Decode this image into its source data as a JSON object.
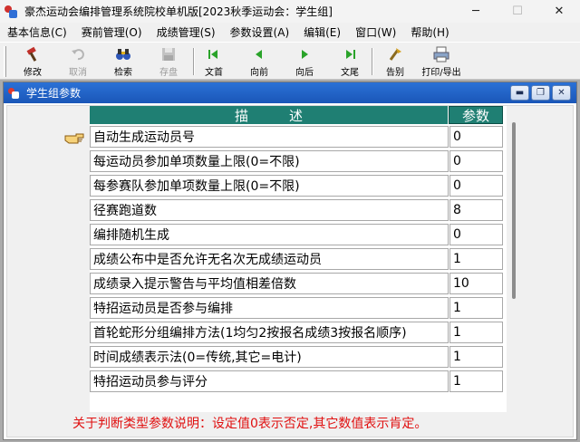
{
  "window": {
    "title": "豪杰运动会编排管理系统院校单机版[2023秋季运动会：学生组]",
    "min_symbol": "─",
    "max_symbol": "☐",
    "close_symbol": "✕"
  },
  "menu": [
    {
      "label": "基本信息(C)"
    },
    {
      "label": "赛前管理(O)"
    },
    {
      "label": "成绩管理(S)"
    },
    {
      "label": "参数设置(A)"
    },
    {
      "label": "编辑(E)"
    },
    {
      "label": "窗口(W)"
    },
    {
      "label": "帮助(H)"
    }
  ],
  "toolbar": {
    "modify": {
      "label": "修改",
      "icon": "hammer-icon"
    },
    "cancel": {
      "label": "取消",
      "icon": "undo-icon"
    },
    "search": {
      "label": "检索",
      "icon": "binoculars-icon"
    },
    "save": {
      "label": "存盘",
      "icon": "floppy-icon"
    },
    "first": {
      "label": "文首",
      "icon": "first-icon"
    },
    "prev": {
      "label": "向前",
      "icon": "prev-icon"
    },
    "next": {
      "label": "向后",
      "icon": "next-icon"
    },
    "last": {
      "label": "文尾",
      "icon": "last-icon"
    },
    "exit": {
      "label": "告别",
      "icon": "exit-icon"
    },
    "print": {
      "label": "打印/导出",
      "icon": "printer-icon"
    }
  },
  "child": {
    "title": "学生组参数",
    "min_symbol": "▬",
    "restore_symbol": "❐",
    "close_symbol": "✕"
  },
  "grid": {
    "headers": {
      "desc": "描　　　述",
      "value": "参数"
    },
    "rows": [
      {
        "desc": "自动生成运动员号",
        "value": "0"
      },
      {
        "desc": "每运动员参加单项数量上限(0=不限)",
        "value": "0"
      },
      {
        "desc": "每参赛队参加单项数量上限(0=不限)",
        "value": "0"
      },
      {
        "desc": "径赛跑道数",
        "value": "8"
      },
      {
        "desc": "编排随机生成",
        "value": "0"
      },
      {
        "desc": "成绩公布中是否允许无名次无成绩运动员",
        "value": "1"
      },
      {
        "desc": "成绩录入提示警告与平均值相差倍数",
        "value": "10"
      },
      {
        "desc": "特招运动员是否参与编排",
        "value": "1"
      },
      {
        "desc": "首轮蛇形分组编排方法(1均匀2按报名成绩3按报名顺序)",
        "value": "1"
      },
      {
        "desc": "时间成绩表示法(0=传统,其它=电计)",
        "value": "1"
      },
      {
        "desc": "特招运动员参与评分",
        "value": "1"
      }
    ]
  },
  "note": "关于判断类型参数说明：设定值0表示否定,其它数值表示肯定。"
}
